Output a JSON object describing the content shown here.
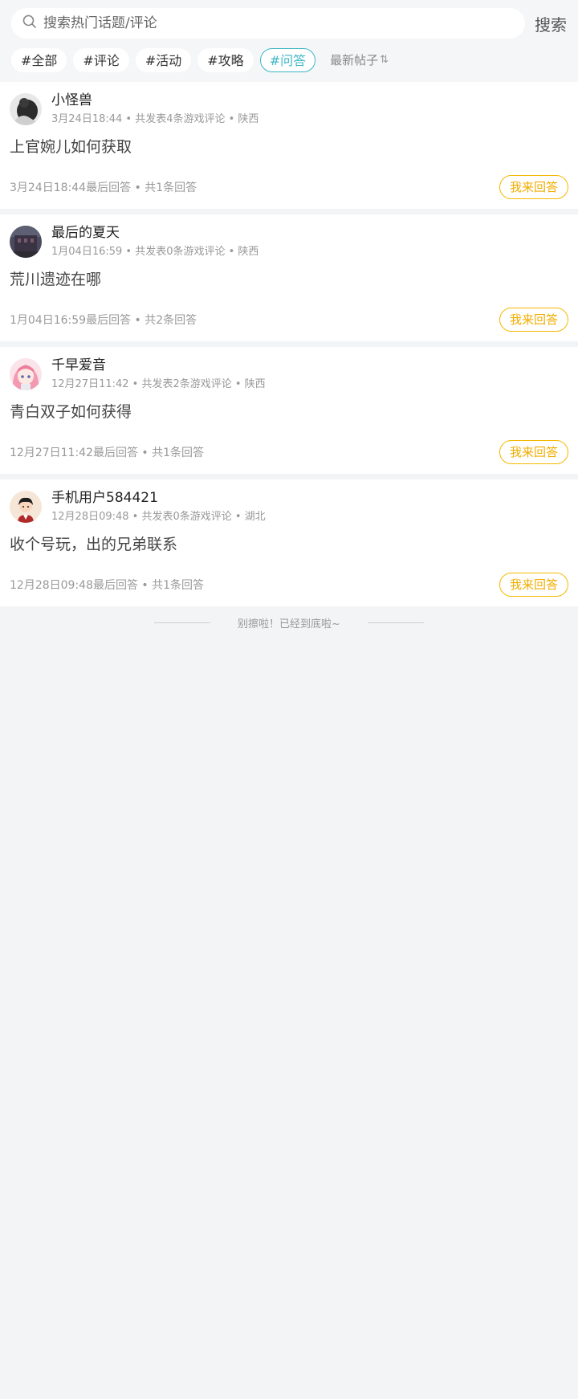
{
  "search": {
    "placeholder": "搜索热门话题/评论",
    "button_label": "搜索"
  },
  "tags": [
    {
      "label": "#全部"
    },
    {
      "label": "#评论"
    },
    {
      "label": "#活动"
    },
    {
      "label": "#攻略"
    },
    {
      "label": "#问答",
      "active": true
    }
  ],
  "sort": {
    "label": "最新帖子",
    "icon": "sort-arrows-icon"
  },
  "posts": [
    {
      "author": "小怪兽",
      "meta": "3月24日18:44 • 共发表4条游戏评论 • 陕西",
      "question": "上官婉儿如何获取",
      "footer": "3月24日18:44最后回答 • 共1条回答",
      "answer_label": "我来回答",
      "avatar": "dark-figure-avatar"
    },
    {
      "author": "最后的夏天",
      "meta": "1月04日16:59 • 共发表0条游戏评论 • 陕西",
      "question": "荒川遗迹在哪",
      "footer": "1月04日16:59最后回答 • 共2条回答",
      "answer_label": "我来回答",
      "avatar": "building-avatar"
    },
    {
      "author": "千早爱音",
      "meta": "12月27日11:42 • 共发表2条游戏评论 • 陕西",
      "question": "青白双子如何获得",
      "footer": "12月27日11:42最后回答 • 共1条回答",
      "answer_label": "我来回答",
      "avatar": "anime-girl-avatar"
    },
    {
      "author": "手机用户584421",
      "meta": "12月28日09:48 • 共发表0条游戏评论 • 湖北",
      "question": "收个号玩，出的兄弟联系",
      "footer": "12月28日09:48最后回答 • 共1条回答",
      "answer_label": "我来回答",
      "avatar": "cartoon-boy-avatar"
    }
  ],
  "end_text": "别擦啦！已经到底啦~",
  "colors": {
    "accent_teal": "#3db6c6",
    "answer_yellow": "#f0ad00",
    "background": "#f3f4f6"
  }
}
